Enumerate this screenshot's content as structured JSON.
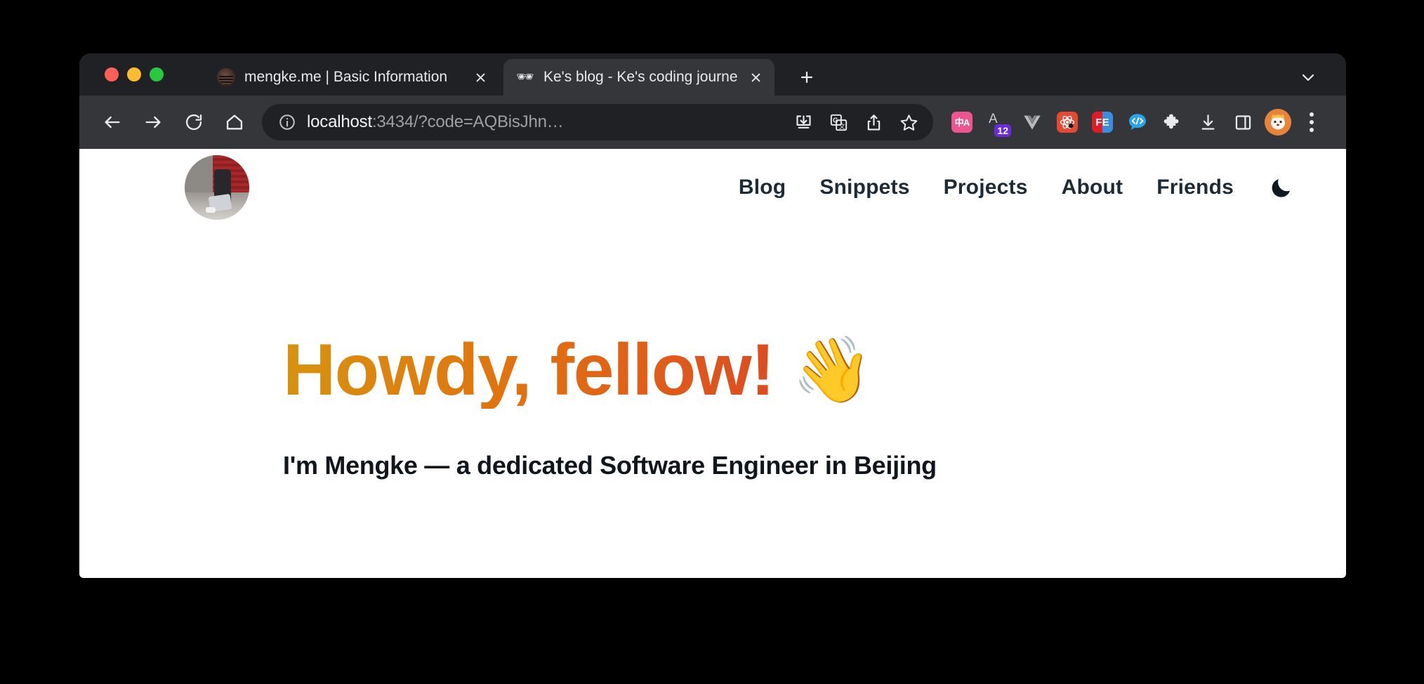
{
  "browser": {
    "window_controls": [
      "close",
      "minimize",
      "maximize"
    ],
    "tabs": [
      {
        "title": "mengke.me | Basic Information",
        "favicon": "mengke-avatar-icon",
        "active": false,
        "close_label": "×"
      },
      {
        "title": "Ke's blog - Ke's coding journey",
        "favicon": "sunglasses-icon",
        "favicon_glyph": "🕶",
        "active": true,
        "close_label": "×"
      }
    ],
    "new_tab_label": "+",
    "tab_list_label": "tab-search",
    "toolbar": {
      "back_label": "Back",
      "forward_label": "Forward",
      "reload_label": "Reload",
      "home_label": "Home",
      "site_info_label": "Site information",
      "url": {
        "host": "localhost",
        "rest": ":3434/?code=AQBisJhn…",
        "full": "localhost:3434/?code=AQBisJhn…"
      },
      "omnibox_actions": [
        {
          "name": "install-app-icon",
          "label": "Install page as app"
        },
        {
          "name": "translate-icon",
          "label": "Translate this page"
        },
        {
          "name": "share-icon",
          "label": "Share this page"
        },
        {
          "name": "bookmark-star-icon",
          "label": "Bookmark this tab"
        }
      ],
      "extensions": [
        {
          "name": "translate-extension-icon",
          "label": "中A",
          "color": "#ed5590"
        },
        {
          "name": "badge-extension-icon",
          "label": "A",
          "badge": "12",
          "badge_color": "#6c2bd9"
        },
        {
          "name": "vue-devtools-icon",
          "label": "Vue",
          "color": "#9aa0a6"
        },
        {
          "name": "react-devtools-icon",
          "label": "React",
          "color": "#e24a33"
        },
        {
          "name": "fe-extension-icon",
          "label": "FE",
          "color": "#e01b24"
        },
        {
          "name": "code-chat-extension-icon",
          "label": "</>",
          "color": "#2aa3e8"
        },
        {
          "name": "puzzle-extensions-icon",
          "label": "Extensions"
        },
        {
          "name": "downloads-icon",
          "label": "Downloads"
        },
        {
          "name": "side-panel-icon",
          "label": "Side panel"
        }
      ],
      "profile_label": "Profile",
      "menu_label": "Customize and control Chrome"
    }
  },
  "site": {
    "avatar_label": "profile-photo",
    "nav": [
      {
        "label": "Blog"
      },
      {
        "label": "Snippets"
      },
      {
        "label": "Projects"
      },
      {
        "label": "About"
      },
      {
        "label": "Friends"
      }
    ],
    "theme_toggle": {
      "name": "moon-icon",
      "label": "Switch to dark mode"
    },
    "hero": {
      "heading": "Howdy, fellow!",
      "emoji": "👋",
      "subtitle": "I'm Mengke — a dedicated Software Engineer in Beijing"
    },
    "colors": {
      "heading_gradient_start": "#d8930f",
      "heading_gradient_mid": "#e0720f",
      "heading_gradient_end": "#de4a22",
      "text": "#10161c",
      "background": "#ffffff"
    }
  }
}
